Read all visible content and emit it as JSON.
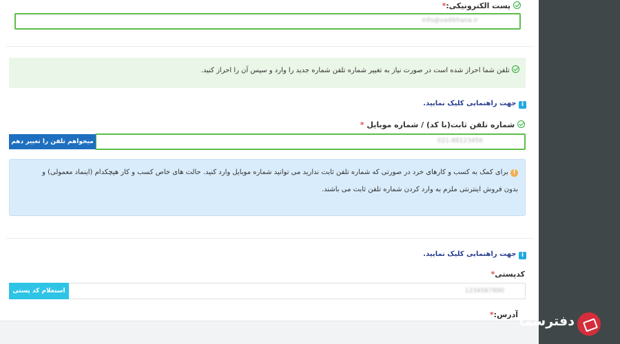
{
  "email_section": {
    "label": "پست الکترونیکی:",
    "required_mark": "*",
    "value": "info@vadikhana.ir"
  },
  "phone_verified_alert": {
    "text": "تلفن شما احراز شده است در صورت نیاز به تغییر شماره تلفن شماره جدید را وارد و سپس آن را احراز کنید."
  },
  "help_link_1": {
    "icon": "i",
    "text": "جهت راهنمایی کلیک نمایید."
  },
  "phone_section": {
    "label": "شماره تلفن ثابت(با کد) / شماره موبایل",
    "required_mark": "*",
    "value": "021-88123456",
    "change_button": "میخواهم تلفن را تغییر دهم"
  },
  "info_alert": {
    "icon": "!",
    "line1": "برای کمک به کسب و کارهای خرد در صورتی که شماره تلفن ثابت ندارید می توانید شماره موبایل وارد کنید. حالت های خاص کسب و کار هیچکدام (اینماد معمولی) و",
    "line2": "بدون فروش اینترنتی ملزم به وارد کردن شماره تلفن ثابت می باشند."
  },
  "help_link_2": {
    "icon": "i",
    "text": "جهت راهنمایی کلیک نمایید."
  },
  "postal_section": {
    "label": "کدپستی",
    "required_mark": "*",
    "value": "1234567890",
    "inquiry_button": "استعلام کد پستی"
  },
  "address_section": {
    "label": "آدرس:",
    "required_mark": "*"
  },
  "brand": {
    "name": "دفترسما"
  },
  "colors": {
    "success_green": "#5cbd45",
    "primary_blue": "#1e6fbf",
    "info_cyan": "#2ec4e6",
    "brand_red": "#d42d3c",
    "side_panel": "#3f4748"
  }
}
